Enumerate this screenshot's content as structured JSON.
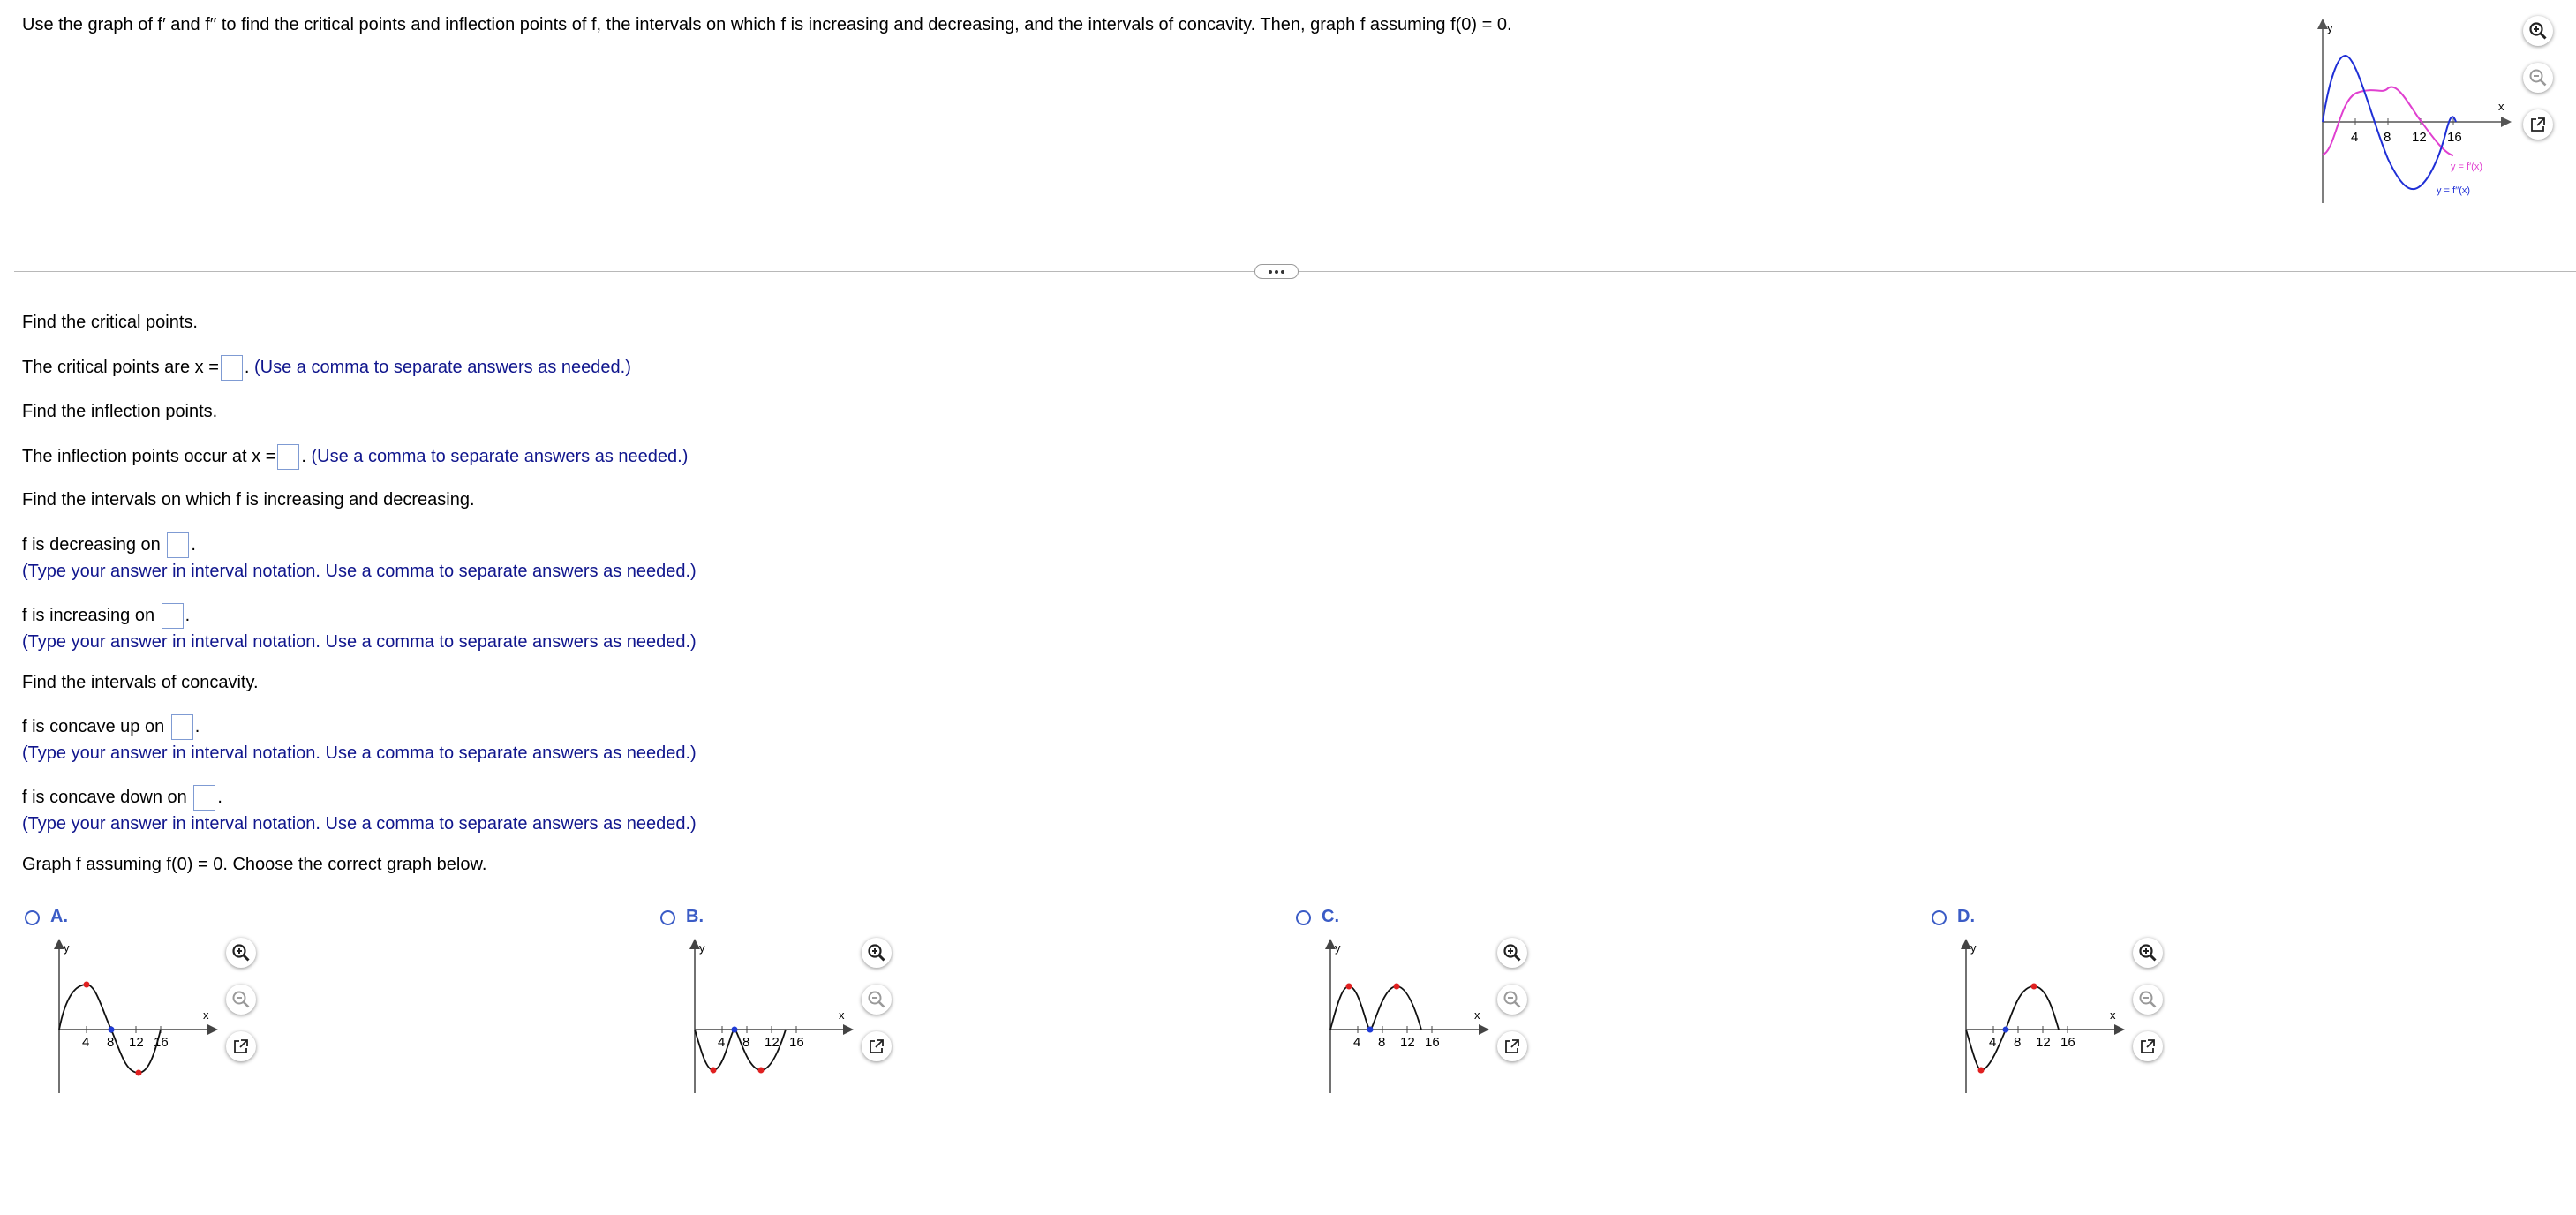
{
  "problem": {
    "text": "Use the graph of f′ and f′′ to find the critical points and inflection points of f, the intervals on which f is increasing and decreasing, and the intervals of concavity. Then, graph f assuming f(0) = 0."
  },
  "main_graph": {
    "y_axis_label": "y",
    "x_axis_label": "x",
    "ticks": [
      "4",
      "8",
      "12",
      "16"
    ],
    "f_prime_label": "y = f′(x)",
    "f_double_prime_label": "y = f′′(x)",
    "colors": {
      "f_prime": "#e040d0",
      "f_double_prime": "#1f2fd6"
    }
  },
  "questions": {
    "critical_heading": "Find the critical points.",
    "critical_prefix": "The critical points are x =",
    "critical_note": "(Use a comma to separate answers as needed.)",
    "inflection_heading": "Find the inflection points.",
    "inflection_prefix": "The inflection points occur at x =",
    "inflection_note": "(Use a comma to separate answers as needed.)",
    "monotonic_heading": "Find the intervals on which f is increasing and decreasing.",
    "decreasing_prefix": "f is decreasing on",
    "increasing_prefix": "f is increasing on",
    "interval_note": "(Type your answer in interval notation. Use a comma to separate answers as needed.)",
    "concavity_heading": "Find the intervals of concavity.",
    "concave_up_prefix": "f is concave up on",
    "concave_down_prefix": "f is concave down on",
    "graph_heading": "Graph f assuming f(0) = 0. Choose the correct graph below.",
    "period": "."
  },
  "options": [
    {
      "label": "A.",
      "y_axis_label": "y",
      "x_axis_label": "x",
      "ticks": [
        "4",
        "8",
        "12",
        "16"
      ]
    },
    {
      "label": "B.",
      "y_axis_label": "y",
      "x_axis_label": "x",
      "ticks": [
        "4",
        "8",
        "12",
        "16"
      ]
    },
    {
      "label": "C.",
      "y_axis_label": "y",
      "x_axis_label": "x",
      "ticks": [
        "4",
        "8",
        "12",
        "16"
      ]
    },
    {
      "label": "D.",
      "y_axis_label": "y",
      "x_axis_label": "x",
      "ticks": [
        "4",
        "8",
        "12",
        "16"
      ]
    }
  ],
  "icons": [
    "zoom-in-icon",
    "zoom-out-icon",
    "new-window-icon"
  ],
  "colors": {
    "note_text": "#10168d",
    "option_accent": "#3b5cc6",
    "max_min_point": "#e02020",
    "inflection_point": "#1f3bd6"
  }
}
